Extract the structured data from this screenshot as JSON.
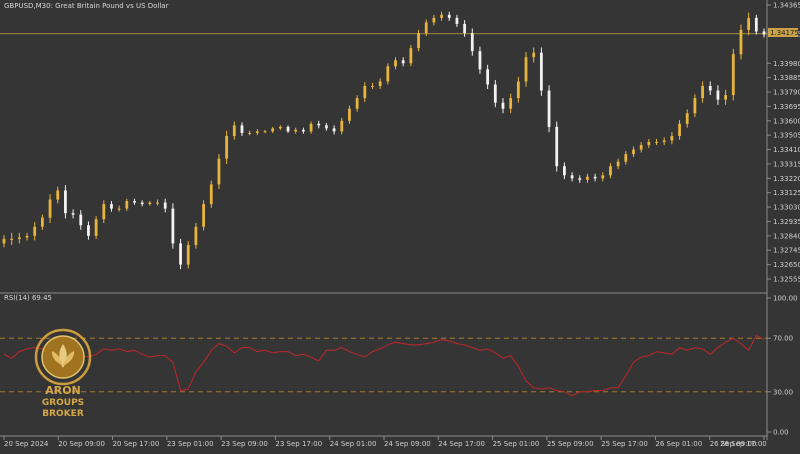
{
  "window": {
    "symbol_title": "GBPUSD,M30: Great Britain Pound vs US Dollar",
    "indicator_title": "RSI(14) 69.45"
  },
  "colors": {
    "background": "#353535",
    "bull_candle": "#e8b53c",
    "bear_candle": "#f2f2f2",
    "rsi_line": "#c0262a",
    "level_line": "#b8862d",
    "bid_line": "#c9a24a",
    "axis_text": "#cfcfcf"
  },
  "price_axis": {
    "ticks": [
      "1.34365",
      "1.34175",
      "1.33980",
      "1.33885",
      "1.33790",
      "1.33695",
      "1.33600",
      "1.33505",
      "1.33410",
      "1.33315",
      "1.33220",
      "1.33125",
      "1.33030",
      "1.32935",
      "1.32840",
      "1.32745",
      "1.32650",
      "1.32555"
    ],
    "current_price": "1.34175"
  },
  "rsi_axis": {
    "ticks": [
      "100.00",
      "70.00",
      "30.00",
      "0.00"
    ]
  },
  "time_axis": {
    "ticks": [
      "20 Sep 2024",
      "20 Sep 09:00",
      "20 Sep 17:00",
      "23 Sep 01:00",
      "23 Sep 09:00",
      "23 Sep 17:00",
      "24 Sep 01:00",
      "24 Sep 09:00",
      "24 Sep 17:00",
      "25 Sep 01:00",
      "25 Sep 09:00",
      "25 Sep 17:00",
      "26 Sep 01:00",
      "26 Sep 09:00",
      "26 Sep 17:00"
    ]
  },
  "logo": {
    "line1": "ARON",
    "line2": "GROUPS",
    "line3": "BROKER"
  },
  "chart_data": [
    {
      "type": "candlestick",
      "symbol": "GBPUSD",
      "timeframe": "M30",
      "close_path": [
        [
          1.3282,
          5
        ],
        [
          1.3282,
          8
        ],
        [
          1.3283,
          6
        ],
        [
          1.3284,
          4
        ],
        [
          1.329,
          6
        ],
        [
          1.3296,
          4
        ],
        [
          1.3308,
          7
        ],
        [
          1.3314,
          5
        ],
        [
          1.3299,
          7
        ],
        [
          1.3298,
          5
        ],
        [
          1.3291,
          6
        ],
        [
          1.3284,
          5
        ],
        [
          1.3295,
          4
        ],
        [
          1.3305,
          5
        ],
        [
          1.3302,
          4
        ],
        [
          1.3302,
          4
        ],
        [
          1.3307,
          3
        ],
        [
          1.3306,
          3
        ],
        [
          1.3305,
          3
        ],
        [
          1.3306,
          2
        ],
        [
          1.3306,
          4
        ],
        [
          1.3302,
          5
        ],
        [
          1.3279,
          7
        ],
        [
          1.3265,
          6
        ],
        [
          1.3278,
          5
        ],
        [
          1.329,
          5
        ],
        [
          1.3305,
          5
        ],
        [
          1.3318,
          5
        ],
        [
          1.3335,
          6
        ],
        [
          1.335,
          7
        ],
        [
          1.3357,
          5
        ],
        [
          1.3352,
          4
        ],
        [
          1.3352,
          3
        ],
        [
          1.3353,
          3
        ],
        [
          1.3353,
          2
        ],
        [
          1.3355,
          2
        ],
        [
          1.3356,
          2
        ],
        [
          1.3353,
          2
        ],
        [
          1.3354,
          3
        ],
        [
          1.3353,
          3
        ],
        [
          1.3358,
          3
        ],
        [
          1.3357,
          4
        ],
        [
          1.3355,
          3
        ],
        [
          1.3353,
          4
        ],
        [
          1.336,
          4
        ],
        [
          1.3368,
          4
        ],
        [
          1.3375,
          4
        ],
        [
          1.3383,
          5
        ],
        [
          1.3383,
          4
        ],
        [
          1.3386,
          4
        ],
        [
          1.3396,
          4
        ],
        [
          1.34,
          4
        ],
        [
          1.3398,
          4
        ],
        [
          1.3408,
          4
        ],
        [
          1.3418,
          4
        ],
        [
          1.3425,
          4
        ],
        [
          1.3428,
          4
        ],
        [
          1.343,
          4
        ],
        [
          1.3428,
          4
        ],
        [
          1.3424,
          4
        ],
        [
          1.3418,
          5
        ],
        [
          1.3406,
          6
        ],
        [
          1.3394,
          6
        ],
        [
          1.3384,
          6
        ],
        [
          1.3372,
          6
        ],
        [
          1.3368,
          6
        ],
        [
          1.3375,
          6
        ],
        [
          1.3386,
          6
        ],
        [
          1.3402,
          7
        ],
        [
          1.3405,
          7
        ],
        [
          1.338,
          7
        ],
        [
          1.3356,
          7
        ],
        [
          1.333,
          7
        ],
        [
          1.3324,
          5
        ],
        [
          1.3322,
          4
        ],
        [
          1.3321,
          4
        ],
        [
          1.3323,
          4
        ],
        [
          1.3322,
          4
        ],
        [
          1.3324,
          4
        ],
        [
          1.333,
          4
        ],
        [
          1.3333,
          4
        ],
        [
          1.3338,
          4
        ],
        [
          1.3341,
          4
        ],
        [
          1.3344,
          4
        ],
        [
          1.3346,
          4
        ],
        [
          1.3346,
          4
        ],
        [
          1.3347,
          4
        ],
        [
          1.335,
          5
        ],
        [
          1.3358,
          5
        ],
        [
          1.3365,
          5
        ],
        [
          1.3375,
          5
        ],
        [
          1.3383,
          6
        ],
        [
          1.338,
          6
        ],
        [
          1.3374,
          7
        ],
        [
          1.3377,
          7
        ],
        [
          1.3404,
          7
        ],
        [
          1.342,
          7
        ],
        [
          1.3428,
          7
        ],
        [
          1.3419,
          4
        ],
        [
          1.3417,
          4
        ]
      ],
      "rsi_path": [
        58,
        55,
        60,
        62,
        63,
        62,
        60,
        57,
        52,
        49,
        57,
        56,
        58,
        62,
        61,
        62,
        60,
        61,
        58,
        56,
        57,
        57,
        52,
        31,
        32,
        45,
        52,
        61,
        66,
        64,
        59,
        63,
        63,
        60,
        61,
        59,
        60,
        60,
        57,
        58,
        56,
        53,
        61,
        61,
        63,
        60,
        58,
        56,
        60,
        62,
        65,
        67,
        66,
        65,
        65,
        66,
        67,
        69,
        68,
        66,
        65,
        63,
        61,
        62,
        59,
        55,
        57,
        49,
        38,
        33,
        32,
        33,
        31,
        30,
        27,
        30,
        30,
        31,
        31,
        33,
        33,
        42,
        52,
        56,
        57,
        60,
        59,
        58,
        63,
        61,
        63,
        62,
        58,
        63,
        67,
        70,
        66,
        61,
        72,
        69
      ]
    }
  ]
}
